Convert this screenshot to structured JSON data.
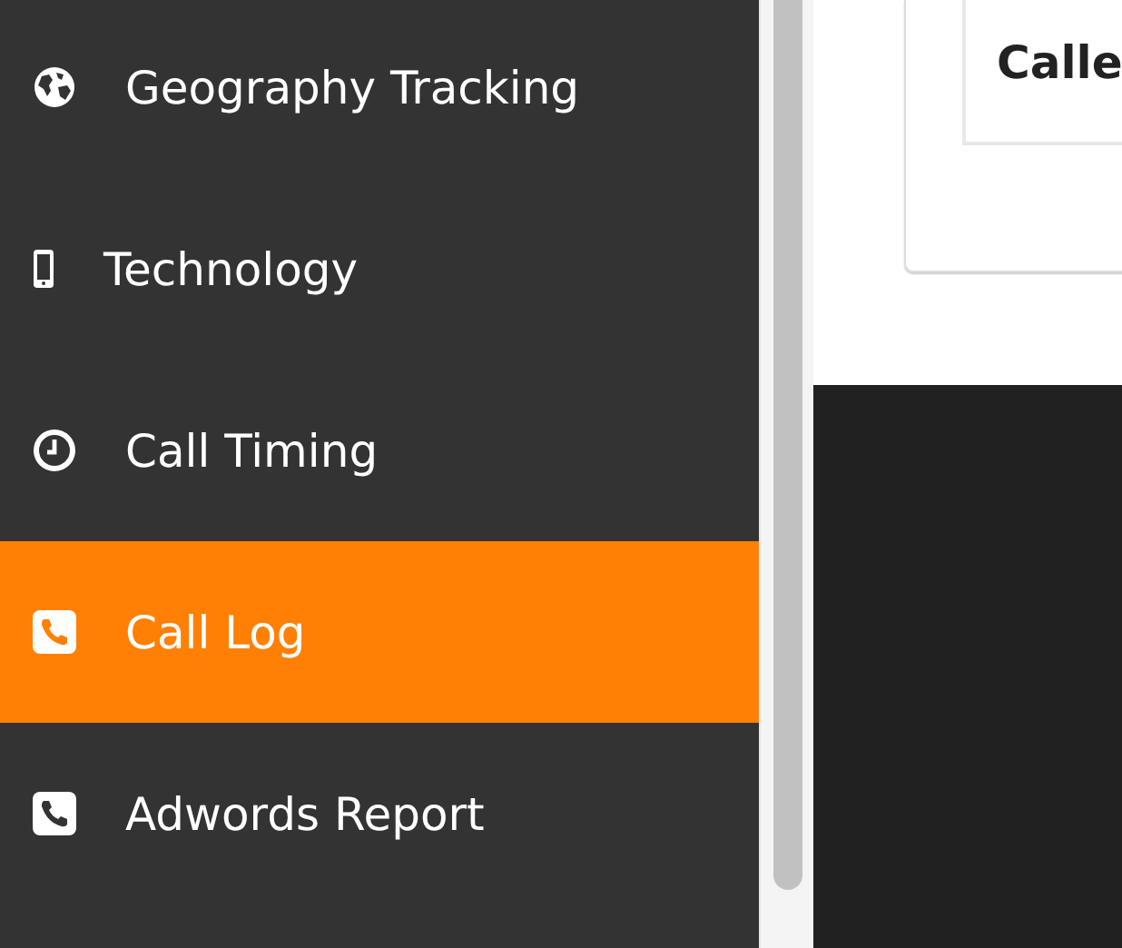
{
  "sidebar": {
    "items": [
      {
        "label": "Geography Tracking",
        "kind": "globe",
        "selected": false
      },
      {
        "label": "Technology",
        "kind": "mobile",
        "selected": false
      },
      {
        "label": "Call Timing",
        "kind": "clock",
        "selected": false
      },
      {
        "label": "Call Log",
        "kind": "phone",
        "selected": true
      },
      {
        "label": "Adwords Report",
        "kind": "phone",
        "selected": false
      }
    ]
  },
  "panel": {
    "heading": "Calle"
  }
}
